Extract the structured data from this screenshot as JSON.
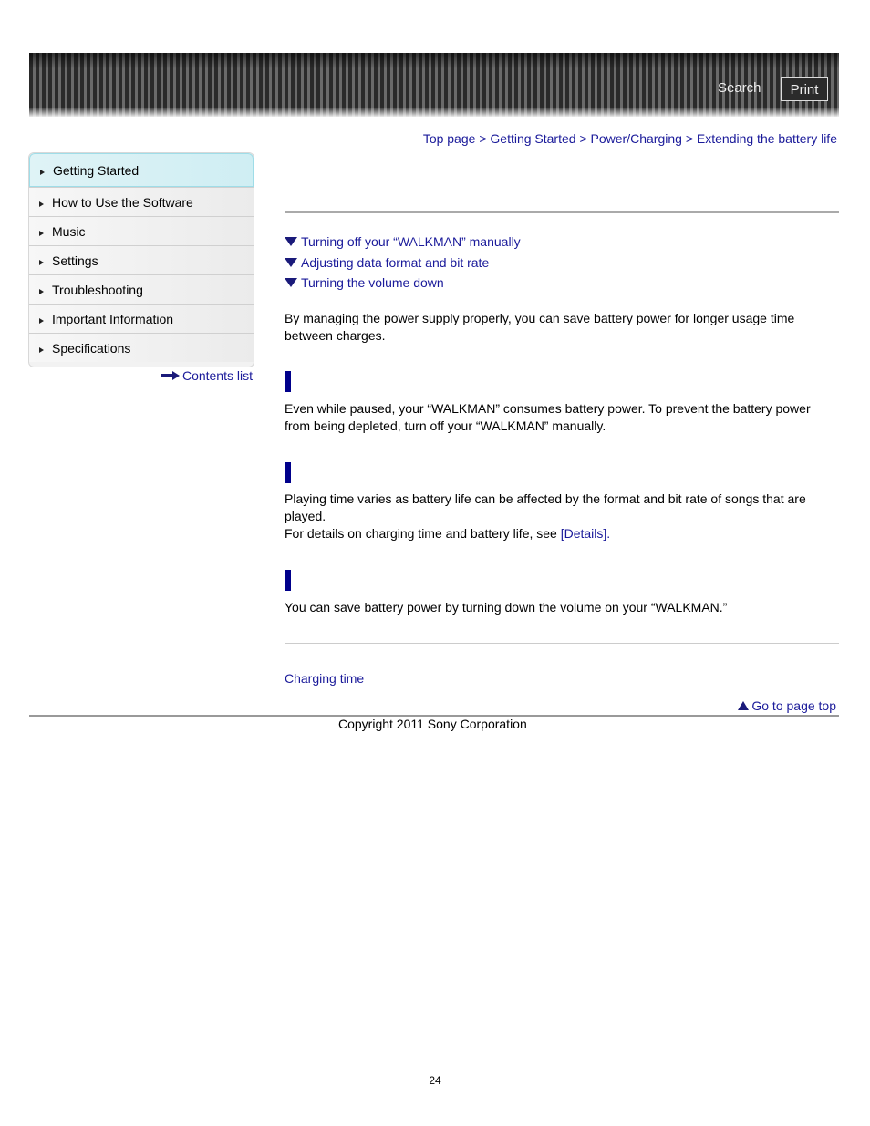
{
  "header": {
    "search_label": "Search",
    "print_label": "Print"
  },
  "breadcrumb": {
    "items": [
      "Top page",
      "Getting Started",
      "Power/Charging",
      "Extending the battery life"
    ],
    "separator": ">"
  },
  "sidebar": {
    "items": [
      {
        "label": "Getting Started",
        "active": true
      },
      {
        "label": "How to Use the Software"
      },
      {
        "label": "Music"
      },
      {
        "label": "Settings"
      },
      {
        "label": "Troubleshooting"
      },
      {
        "label": "Important Information"
      },
      {
        "label": "Specifications"
      }
    ],
    "contents_list_label": "Contents list"
  },
  "toc": {
    "items": [
      "Turning off your “WALKMAN” manually",
      "Adjusting data format and bit rate",
      "Turning the volume down"
    ]
  },
  "content": {
    "intro": "By managing the power supply properly, you can save battery power for longer usage time between charges.",
    "section1_text": "Even while paused, your “WALKMAN” consumes battery power. To prevent the battery power from being depleted, turn off your “WALKMAN” manually.",
    "section2_line1": "Playing time varies as battery life can be affected by the format and bit rate of songs that are played.",
    "section2_line2": "For details on charging time and battery life, see ",
    "section2_link": "[Details]",
    "section2_end": ".",
    "section3_text": "You can save battery power by turning down the volume on your “WALKMAN.”"
  },
  "related": {
    "link": "Charging time"
  },
  "footer": {
    "page_top_label": "Go to page top",
    "copyright": "Copyright 2011 Sony Corporation",
    "page_number": "24"
  },
  "colors": {
    "link": "#1a1a9a",
    "section_bar": "#00008b",
    "active_nav": "#d6f1f5"
  }
}
